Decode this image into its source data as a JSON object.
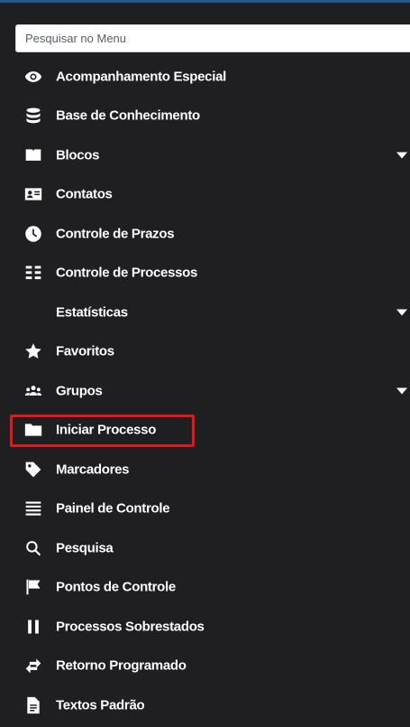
{
  "search": {
    "placeholder": "Pesquisar no Menu",
    "value": ""
  },
  "menu": {
    "items": [
      {
        "label": "Acompanhamento Especial",
        "icon": "eye-icon",
        "has_submenu": false
      },
      {
        "label": "Base de Conhecimento",
        "icon": "database-icon",
        "has_submenu": false
      },
      {
        "label": "Blocos",
        "icon": "book-open-icon",
        "has_submenu": true
      },
      {
        "label": "Contatos",
        "icon": "contact-card-icon",
        "has_submenu": false
      },
      {
        "label": "Controle de Prazos",
        "icon": "clock-icon",
        "has_submenu": false
      },
      {
        "label": "Controle de Processos",
        "icon": "list-columns-icon",
        "has_submenu": false
      },
      {
        "label": "Estatísticas",
        "icon": "",
        "has_submenu": true
      },
      {
        "label": "Favoritos",
        "icon": "star-icon",
        "has_submenu": false
      },
      {
        "label": "Grupos",
        "icon": "users-icon",
        "has_submenu": true
      },
      {
        "label": "Iniciar Processo",
        "icon": "folder-icon",
        "has_submenu": false,
        "highlighted": true
      },
      {
        "label": "Marcadores",
        "icon": "tag-icon",
        "has_submenu": false
      },
      {
        "label": "Painel de Controle",
        "icon": "bars-icon",
        "has_submenu": false
      },
      {
        "label": "Pesquisa",
        "icon": "search-icon",
        "has_submenu": false
      },
      {
        "label": "Pontos de Controle",
        "icon": "flag-icon",
        "has_submenu": false
      },
      {
        "label": "Processos Sobrestados",
        "icon": "pause-icon",
        "has_submenu": false
      },
      {
        "label": "Retorno Programado",
        "icon": "exchange-icon",
        "has_submenu": false
      },
      {
        "label": "Textos Padrão",
        "icon": "file-text-icon",
        "has_submenu": false
      }
    ]
  },
  "colors": {
    "background": "#1f1f21",
    "text": "#ffffff",
    "highlight_border": "#e3161b",
    "top_border": "#1f5b86"
  }
}
